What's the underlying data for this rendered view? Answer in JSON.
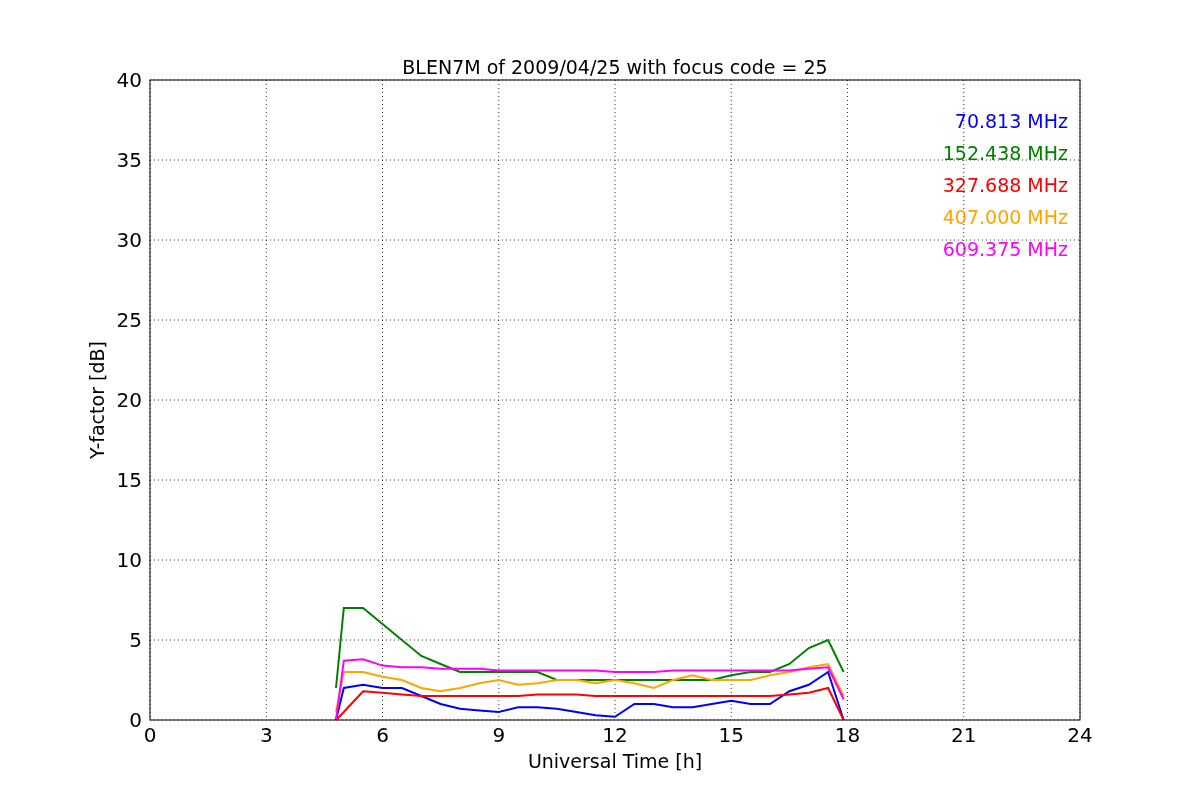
{
  "chart_data": {
    "type": "line",
    "title": "BLEN7M of 2009/04/25 with focus code = 25",
    "xlabel": "Universal Time [h]",
    "ylabel": "Y-factor [dB]",
    "x": [
      4.8,
      5.0,
      5.5,
      6.0,
      6.5,
      7.0,
      7.5,
      8.0,
      8.5,
      9.0,
      9.5,
      10.0,
      10.5,
      11.0,
      11.5,
      12.0,
      12.5,
      13.0,
      13.5,
      14.0,
      14.5,
      15.0,
      15.5,
      16.0,
      16.5,
      17.0,
      17.5,
      17.9
    ],
    "grid": true,
    "xlim": [
      0,
      24
    ],
    "ylim": [
      0,
      40
    ],
    "xticks": [
      0,
      3,
      6,
      9,
      12,
      15,
      18,
      21,
      24
    ],
    "yticks": [
      0,
      5,
      10,
      15,
      20,
      25,
      30,
      35,
      40
    ],
    "series": [
      {
        "name": "70.813 MHz",
        "color": "#0000ff",
        "values": [
          0,
          2,
          2.2,
          2,
          2,
          1.5,
          1,
          0.7,
          0.6,
          0.5,
          0.8,
          0.8,
          0.7,
          0.5,
          0.3,
          0.2,
          1,
          1,
          0.8,
          0.8,
          1,
          1.2,
          1,
          1,
          1.8,
          2.2,
          3,
          0
        ]
      },
      {
        "name": "152.438 MHz",
        "color": "#008000",
        "values": [
          2,
          7,
          7,
          6,
          5,
          4,
          3.5,
          3,
          3,
          3,
          3,
          3,
          2.5,
          2.5,
          2.5,
          2.5,
          2.5,
          2.5,
          2.5,
          2.5,
          2.5,
          2.8,
          3,
          3,
          3.5,
          4.5,
          5,
          3
        ]
      },
      {
        "name": "327.688 MHz",
        "color": "#ff0000",
        "values": [
          0,
          0.5,
          1.8,
          1.7,
          1.6,
          1.5,
          1.5,
          1.5,
          1.5,
          1.5,
          1.5,
          1.6,
          1.6,
          1.6,
          1.5,
          1.5,
          1.5,
          1.5,
          1.5,
          1.5,
          1.5,
          1.5,
          1.5,
          1.5,
          1.6,
          1.7,
          2,
          0
        ]
      },
      {
        "name": "407.000 MHz",
        "color": "#ffa500",
        "values": [
          0.5,
          3,
          3,
          2.7,
          2.5,
          2,
          1.8,
          2,
          2.3,
          2.5,
          2.2,
          2.3,
          2.5,
          2.5,
          2.3,
          2.5,
          2.3,
          2,
          2.5,
          2.8,
          2.5,
          2.5,
          2.5,
          2.8,
          3,
          3.3,
          3.5,
          1.5
        ]
      },
      {
        "name": "609.375 MHz",
        "color": "#ff00ff",
        "values": [
          0,
          3.7,
          3.8,
          3.4,
          3.3,
          3.3,
          3.2,
          3.2,
          3.2,
          3.1,
          3.1,
          3.1,
          3.1,
          3.1,
          3.1,
          3,
          3,
          3,
          3.1,
          3.1,
          3.1,
          3.1,
          3.1,
          3.1,
          3.1,
          3.2,
          3.3,
          1.3
        ]
      }
    ]
  }
}
